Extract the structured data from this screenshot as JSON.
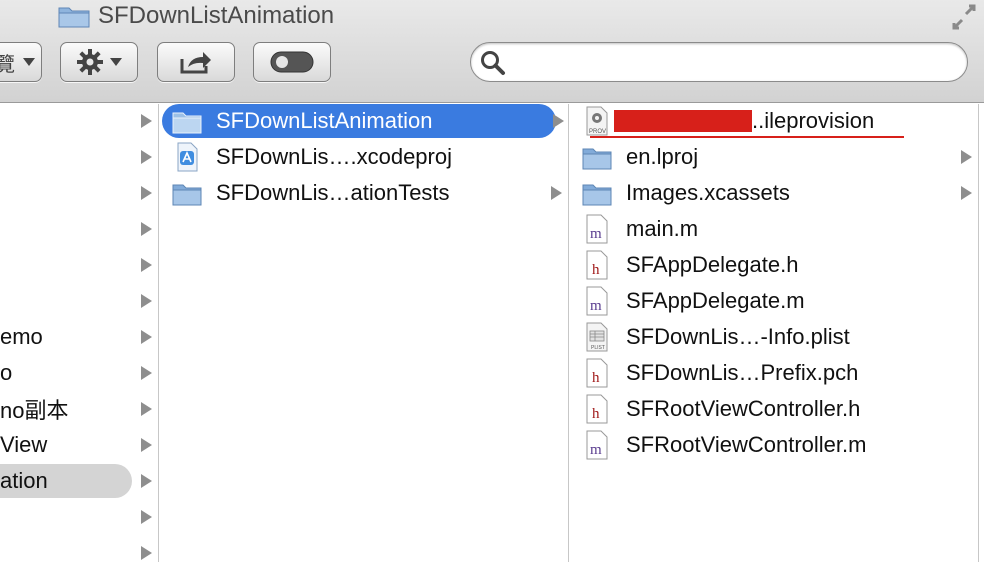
{
  "window": {
    "title": "SFDownListAnimation"
  },
  "toolbar": {
    "view_glyph": "覽",
    "search_value": "",
    "search_placeholder": ""
  },
  "column1": {
    "items": [
      {
        "label": "",
        "disclosure": true
      },
      {
        "label": "",
        "disclosure": true
      },
      {
        "label": "",
        "disclosure": true
      },
      {
        "label": "",
        "disclosure": true
      },
      {
        "label": "",
        "disclosure": true
      },
      {
        "label": "",
        "disclosure": true
      },
      {
        "label": "emo",
        "disclosure": true
      },
      {
        "label": "o",
        "disclosure": true
      },
      {
        "label": "no副本",
        "disclosure": true
      },
      {
        "label": "View",
        "disclosure": true
      },
      {
        "label": "ation",
        "disclosure": true,
        "selected": true
      },
      {
        "label": "",
        "disclosure": true
      },
      {
        "label": "",
        "disclosure": true
      }
    ]
  },
  "column2": {
    "items": [
      {
        "label": "SFDownListAnimation",
        "icon": "folder-icon",
        "selected": true
      },
      {
        "label": "SFDownLis….xcodeproj",
        "icon": "xcodeproj-icon"
      },
      {
        "label": "SFDownLis…ationTests",
        "icon": "folder-icon"
      }
    ]
  },
  "column3": {
    "items": [
      {
        "label": "..ileprovision",
        "icon": "provision-icon"
      },
      {
        "label": "en.lproj",
        "icon": "folder-icon"
      },
      {
        "label": "Images.xcassets",
        "icon": "folder-icon"
      },
      {
        "label": "main.m",
        "icon": "m-file-icon"
      },
      {
        "label": "SFAppDelegate.h",
        "icon": "h-file-icon"
      },
      {
        "label": "SFAppDelegate.m",
        "icon": "m-file-icon"
      },
      {
        "label": "SFDownLis…-Info.plist",
        "icon": "plist-icon"
      },
      {
        "label": "SFDownLis…Prefix.pch",
        "icon": "h-file-icon"
      },
      {
        "label": "SFRootViewController.h",
        "icon": "h-file-icon"
      },
      {
        "label": "SFRootViewController.m",
        "icon": "m-file-icon"
      }
    ]
  },
  "colors": {
    "selection": "#3a7be0",
    "redaction": "#d7201a",
    "folder": "#7aa6d6"
  }
}
